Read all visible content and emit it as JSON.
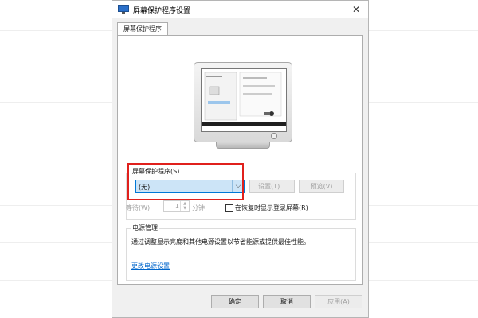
{
  "window": {
    "title": "屏幕保护程序设置",
    "close_glyph": "✕"
  },
  "tab": {
    "label": "屏幕保护程序"
  },
  "screensaver": {
    "group_label": "屏幕保护程序(S)",
    "selected": "(无)",
    "settings_button": "设置(T)...",
    "preview_button": "预览(V)",
    "wait_label": "等待(W):",
    "wait_value": "1",
    "wait_unit": "分钟",
    "resume_checkbox_label": "在恢复时显示登录屏幕(R)",
    "resume_checked": false
  },
  "power": {
    "group_label": "电源管理",
    "description": "通过调整显示亮度和其他电源设置以节省能源或提供最佳性能。",
    "link": "更改电源设置"
  },
  "footer": {
    "ok": "确定",
    "cancel": "取消",
    "apply": "应用(A)"
  },
  "colors": {
    "accent": "#0078d7",
    "highlight": "#e0201c",
    "link": "#0066cc"
  }
}
